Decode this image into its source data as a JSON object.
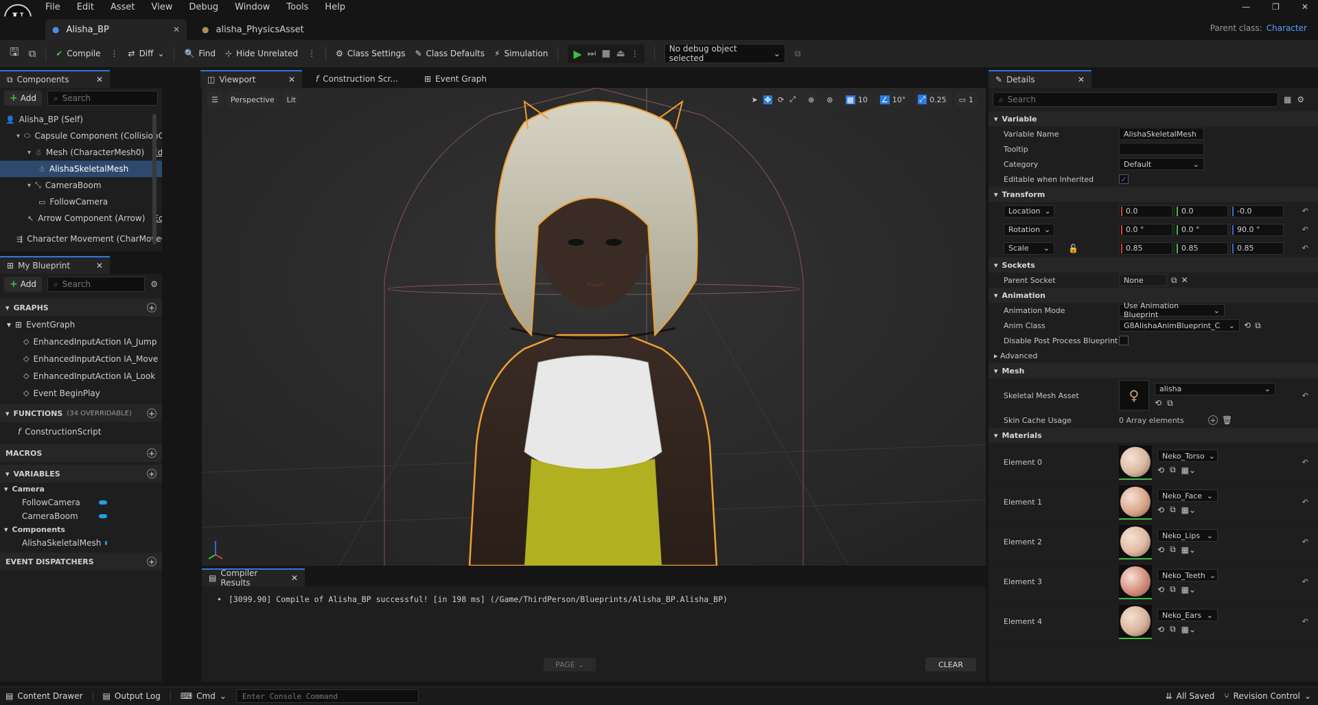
{
  "menu": {
    "items": [
      "File",
      "Edit",
      "Asset",
      "View",
      "Debug",
      "Window",
      "Tools",
      "Help"
    ]
  },
  "tabs": {
    "primary": "Alisha_BP",
    "secondary": "alisha_PhysicsAsset"
  },
  "parent_class": {
    "label": "Parent class:",
    "value": "Character"
  },
  "toolbar": {
    "compile": "Compile",
    "diff": "Diff",
    "find": "Find",
    "hide_unrelated": "Hide Unrelated",
    "class_settings": "Class Settings",
    "class_defaults": "Class Defaults",
    "simulation": "Simulation",
    "debug_object": "No debug object selected"
  },
  "components": {
    "title": "Components",
    "add": "Add",
    "search_placeholder": "Search",
    "tree": [
      {
        "label": "Alisha_BP (Self)",
        "indent": 0,
        "icon": "person-icon"
      },
      {
        "label": "Capsule Component (CollisionCylinder)",
        "indent": 1,
        "icon": "capsule-icon"
      },
      {
        "label": "Mesh (CharacterMesh0)",
        "indent": 2,
        "icon": "skeletal-mesh-icon",
        "link": "Edit in C++"
      },
      {
        "label": "AlishaSkeletalMesh",
        "indent": 3,
        "icon": "skeletal-mesh-icon",
        "selected": true
      },
      {
        "label": "CameraBoom",
        "indent": 2,
        "icon": "spring-arm-icon"
      },
      {
        "label": "FollowCamera",
        "indent": 3,
        "icon": "camera-icon"
      },
      {
        "label": "Arrow Component (Arrow)",
        "indent": 2,
        "icon": "arrow-icon",
        "link": "Edit in C++"
      },
      {
        "label": "Character Movement (CharMoveComp)",
        "indent": 1,
        "icon": "movement-icon"
      }
    ]
  },
  "my_blueprint": {
    "title": "My Blueprint",
    "add": "Add",
    "search_placeholder": "Search",
    "graphs_label": "GRAPHS",
    "event_graph": "EventGraph",
    "events": [
      "EnhancedInputAction IA_Jump",
      "EnhancedInputAction IA_Move",
      "EnhancedInputAction IA_Look",
      "Event BeginPlay"
    ],
    "functions_label": "FUNCTIONS",
    "functions_count": "(34 OVERRIDABLE)",
    "functions": [
      "ConstructionScript"
    ],
    "macros_label": "MACROS",
    "variables_label": "VARIABLES",
    "camera_cat": "Camera",
    "camera_vars": [
      "FollowCamera",
      "CameraBoom"
    ],
    "components_cat": "Components",
    "component_vars": [
      "AlishaSkeletalMesh"
    ],
    "dispatchers_label": "EVENT DISPATCHERS"
  },
  "center_tabs": [
    "Viewport",
    "Construction Scr...",
    "Event Graph"
  ],
  "viewport": {
    "perspective": "Perspective",
    "lit": "Lit",
    "grid_snap": "10",
    "rot_snap": "10°",
    "scale_snap": "0.25",
    "camera_speed": "1"
  },
  "compiler": {
    "title": "Compiler Results",
    "message": "[3099.90] Compile of Alisha_BP successful! [in 198 ms] (/Game/ThirdPerson/Blueprints/Alisha_BP.Alisha_BP)",
    "page": "PAGE",
    "clear": "CLEAR"
  },
  "details": {
    "title": "Details",
    "search_placeholder": "Search",
    "variable_section": "Variable",
    "variable_name_label": "Variable Name",
    "variable_name": "AlishaSkeletalMesh",
    "tooltip_label": "Tooltip",
    "tooltip_value": "",
    "category_label": "Category",
    "category": "Default",
    "editable_label": "Editable when Inherited",
    "transform_section": "Transform",
    "location_label": "Location",
    "location": [
      "0.0",
      "0.0",
      "-0.0"
    ],
    "rotation_label": "Rotation",
    "rotation": [
      "0.0 °",
      "0.0 °",
      "90.0 °"
    ],
    "scale_label": "Scale",
    "scale": [
      "0.85",
      "0.85",
      "0.85"
    ],
    "sockets_section": "Sockets",
    "parent_socket_label": "Parent Socket",
    "parent_socket": "None",
    "animation_section": "Animation",
    "anim_mode_label": "Animation Mode",
    "anim_mode": "Use Animation Blueprint",
    "anim_class_label": "Anim Class",
    "anim_class": "G8AlishaAnimBlueprint_C",
    "disable_pp_label": "Disable Post Process Blueprint",
    "advanced_label": "Advanced",
    "mesh_section": "Mesh",
    "skeletal_mesh_label": "Skeletal Mesh Asset",
    "skeletal_mesh": "alisha",
    "skin_cache_label": "Skin Cache Usage",
    "skin_cache": "0 Array elements",
    "materials_section": "Materials",
    "materials": [
      {
        "label": "Element 0",
        "value": "Neko_Torso",
        "color": "#d9b8a0"
      },
      {
        "label": "Element 1",
        "value": "Neko_Face",
        "color": "#d8a58a"
      },
      {
        "label": "Element 2",
        "value": "Neko_Lips",
        "color": "#e0b9a2"
      },
      {
        "label": "Element 3",
        "value": "Neko_Teeth",
        "color": "#d48c7c"
      },
      {
        "label": "Element 4",
        "value": "Neko_Ears",
        "color": "#d8b29a"
      }
    ]
  },
  "statusbar": {
    "content_drawer": "Content Drawer",
    "output_log": "Output Log",
    "cmd": "Cmd",
    "console_placeholder": "Enter Console Command",
    "saved": "All Saved",
    "revision": "Revision Control"
  },
  "colors": {
    "accent": "#2b7ae0",
    "selection": "#2d4a6e",
    "outline": "#f0a030",
    "play": "#3fbf3f"
  }
}
